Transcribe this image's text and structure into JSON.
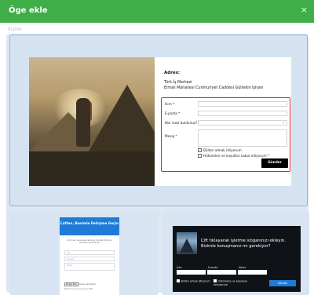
{
  "header": {
    "title": "Öge ekle",
    "close": "×"
  },
  "section_label": "Kişiler",
  "main_card": {
    "address_heading": "Adres:",
    "address_line1": "Türk İş Merkezi",
    "address_line2": "Elmalı Mahallesi Cumhuriyet Caddesi Gültekin İşhanı",
    "form": {
      "name_label": "İsim *",
      "email_label": "E-posta *",
      "source_label": "Bizi nasıl buldunuz? *",
      "message_label": "Mesaj *",
      "newsletter_label": "Bülten almak istiyorum",
      "terms_label": "Hükümleri ve koşulları kabul ediyorum *",
      "submit": "Gönder"
    }
  },
  "card_b": {
    "banner": "Lütfen, Benimle İletişime Geçin",
    "sub": "Add your business name by double clicking, Goodluck with it.out",
    "fields": [
      "İsim",
      "E-posta",
      "Mesaj"
    ],
    "file_button": "Dosya Seç",
    "file_note": "Dosya seçilmedi",
    "size_note": "Maksimum dosya boyutu 5MB"
  },
  "card_c": {
    "heading": "Çift tıklayarak işletme sloganınızı ekleyin. Bizimle konuşmanız mı gerekiyor?",
    "labels": [
      "İsim",
      "E-posta",
      "Adres"
    ],
    "check1": "Bülten almak istiyorum",
    "check2": "Hükümlere ve koşullara katılıyorum",
    "button": "Gönder"
  }
}
